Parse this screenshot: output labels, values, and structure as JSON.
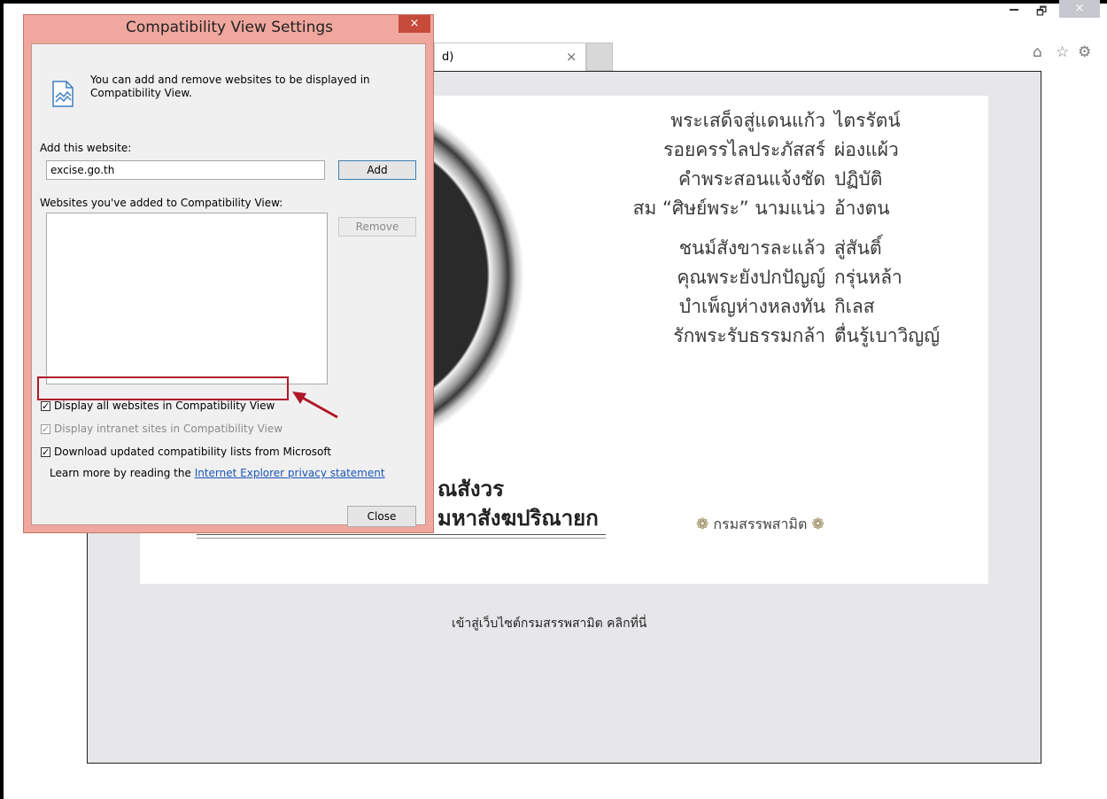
{
  "browser": {
    "tab_title": "d)",
    "tab_close": "×",
    "window": {
      "minimize": "–",
      "restore": "🗗",
      "close": "×"
    },
    "toolbar_icons": [
      "home-icon",
      "favorites-star-icon",
      "settings-gear-icon"
    ]
  },
  "page": {
    "poem": [
      [
        "พระเสด็จสู่แดนแก้ว",
        "ไตรรัตน์"
      ],
      [
        "รอยครรไลประภัสสร์",
        "ผ่องแผ้ว"
      ],
      [
        "คำพระสอนแจ้งชัด",
        "ปฏิบัติ"
      ],
      [
        "สม “ศิษย์พระ” นามแน่ว",
        "อ้างตน"
      ],
      [
        "ชนม์สังขารละแล้ว",
        "สู่สันติ์"
      ],
      [
        "คุณพระยังปกปัญญ์",
        "กรุ่นหล้า"
      ],
      [
        "บำเพ็ญห่างหลงทัน",
        "กิเลส"
      ],
      [
        "รักพระรับธรรมกล้า",
        "ตื่นรู้เบาวิญญ์"
      ]
    ],
    "title_main": "ณสังวร",
    "title_sub": "มหาสังฆปริณายก",
    "department": "กรมสรรพสามิต",
    "enter_link": "เข้าสู่เว็บไซต์กรมสรรพสามิต คลิกที่นี่"
  },
  "dialog": {
    "title": "Compatibility View Settings",
    "close": "×",
    "intro": "You can add and remove websites to be displayed in Compatibility View.",
    "add_label": "Add this website:",
    "add_value": "excise.go.th",
    "add_button": "Add",
    "list_label": "Websites you've added to Compatibility View:",
    "remove_button": "Remove",
    "check_all": {
      "label": "Display all websites in Compatibility View",
      "checked": true
    },
    "check_intranet": {
      "label": "Display intranet sites in Compatibility View",
      "checked": true,
      "disabled": true
    },
    "check_download": {
      "label": "Download updated compatibility lists from Microsoft",
      "checked": true
    },
    "learn_more_prefix": "Learn more by reading the ",
    "learn_more_link": "Internet Explorer privacy statement",
    "close_button": "Close"
  },
  "colors": {
    "dialog_frame": "#f0a79e",
    "highlight_box": "#b0182a",
    "annotation_arrow": "#b0182a",
    "link": "#1a55b8"
  }
}
